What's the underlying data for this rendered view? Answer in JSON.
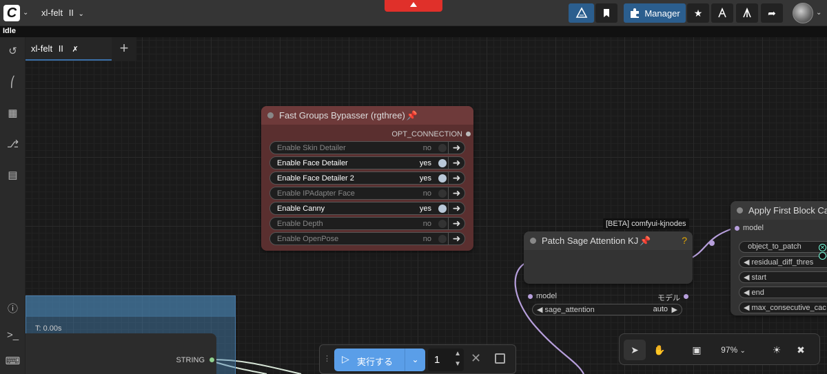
{
  "header": {
    "workflow_title": "xl-felt",
    "workflow_marker": "II",
    "manager_label": "Manager"
  },
  "status": {
    "text": "Idle"
  },
  "tab": {
    "name": "xl-felt",
    "marker": "II",
    "add": "+"
  },
  "fast_groups_bypasser": {
    "title": "Fast Groups Bypasser (rgthree)",
    "output": "OPT_CONNECTION",
    "toggles": [
      {
        "label": "Enable Skin Detailer",
        "value": "no",
        "on": false
      },
      {
        "label": "Enable Face Detailer",
        "value": "yes",
        "on": true
      },
      {
        "label": "Enable Face Detailer 2",
        "value": "yes",
        "on": true
      },
      {
        "label": "Enable IPAdapter Face",
        "value": "no",
        "on": false
      },
      {
        "label": "Enable Canny",
        "value": "yes",
        "on": true
      },
      {
        "label": "Enable Depth",
        "value": "no",
        "on": false
      },
      {
        "label": "Enable OpenPose",
        "value": "no",
        "on": false
      }
    ]
  },
  "patch_sage": {
    "badge": "[BETA] comfyui-kjnodes",
    "title": "Patch Sage Attention KJ",
    "help": "?",
    "input": "model",
    "output": "モデル",
    "widget_label": "sage_attention",
    "widget_value": "auto"
  },
  "apply_fbc": {
    "title": "Apply First Block Ca",
    "input": "model",
    "widgets": [
      "object_to_patch",
      "residual_diff_thres",
      "start",
      "end",
      "max_consecutive_cac"
    ]
  },
  "blue_group": {
    "time": "T: 0.00s"
  },
  "string_node": {
    "output": "STRING"
  },
  "run": {
    "label": "実行する",
    "count": "1"
  },
  "toolbox": {
    "zoom": "97%"
  }
}
